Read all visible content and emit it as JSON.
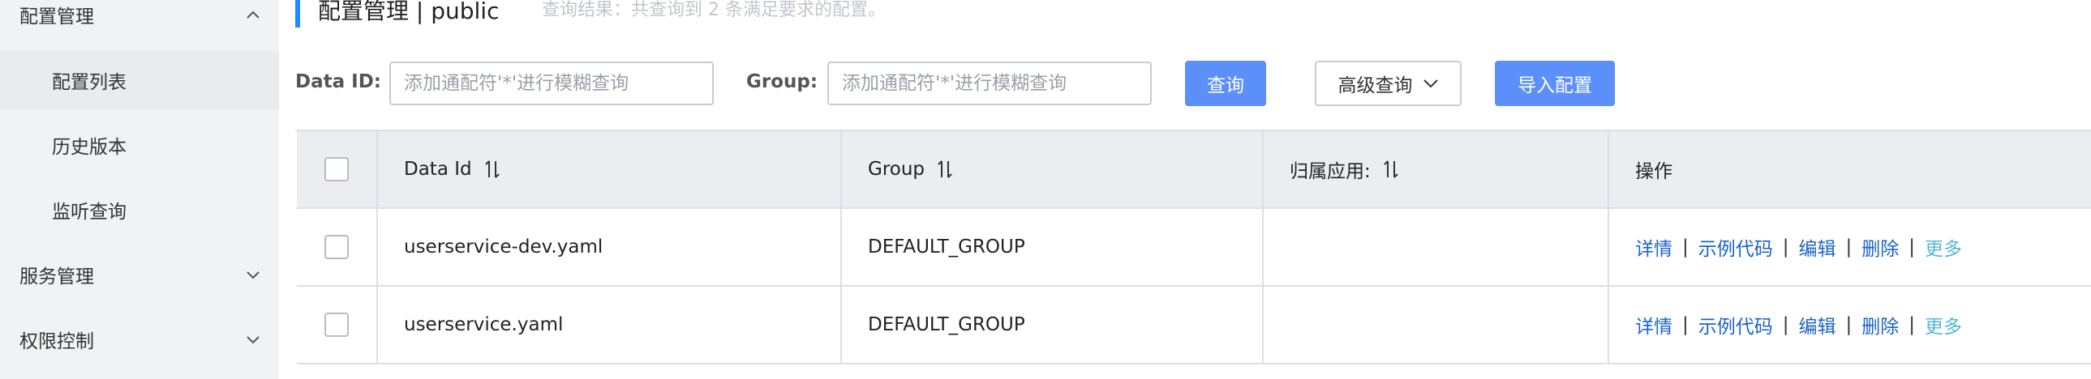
{
  "sidebar": {
    "config_management": "配置管理",
    "config_list": "配置列表",
    "history": "历史版本",
    "listening_query": "监听查询",
    "service_management": "服务管理",
    "access_control": "权限控制"
  },
  "header": {
    "title": "配置管理 | public",
    "query_result": "查询结果：共查询到 2 条满足要求的配置。"
  },
  "search": {
    "data_id_label": "Data ID:",
    "data_id_placeholder": "添加通配符'*'进行模糊查询",
    "group_label": "Group:",
    "group_placeholder": "添加通配符'*'进行模糊查询",
    "query_button": "查询",
    "advanced_query_button": "高级查询",
    "import_button": "导入配置"
  },
  "table": {
    "headers": {
      "data_id": "Data Id",
      "group": "Group",
      "app": "归属应用:",
      "actions": "操作"
    },
    "rows": [
      {
        "data_id": "userservice-dev.yaml",
        "group": "DEFAULT_GROUP",
        "app": ""
      },
      {
        "data_id": "userservice.yaml",
        "group": "DEFAULT_GROUP",
        "app": ""
      }
    ],
    "actions": {
      "details": "详情",
      "sample_code": "示例代码",
      "edit": "编辑",
      "delete": "删除",
      "more": "更多",
      "separator": "|"
    }
  },
  "colors": {
    "primary": "#5b8ff9",
    "link": "#1b63c9",
    "more_link": "#56b7d8",
    "sidebar_bg": "#f0f2f5",
    "accent_bar": "#1e8cff"
  }
}
